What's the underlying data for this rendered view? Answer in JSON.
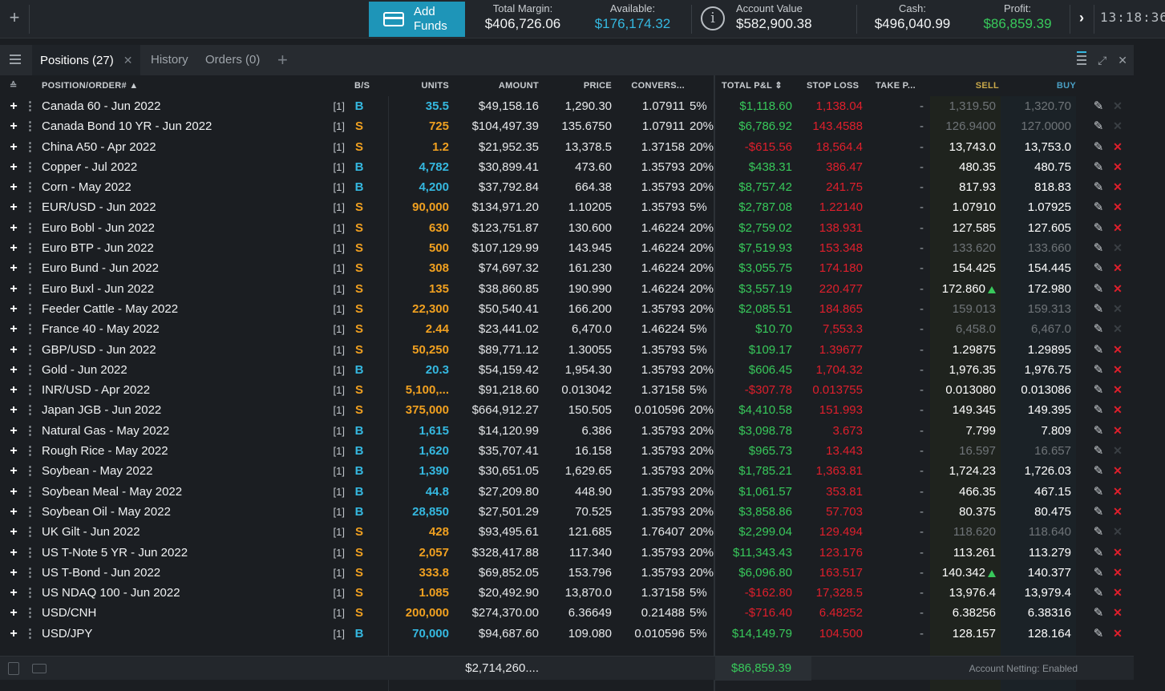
{
  "topbar": {
    "add_funds": "Add\nFunds",
    "total_margin_label": "Total Margin:",
    "total_margin": "$406,726.06",
    "available_label": "Available:",
    "available": "$176,174.32",
    "account_value_label": "Account Value",
    "account_value": "$582,900.38",
    "cash_label": "Cash:",
    "cash": "$496,040.99",
    "profit_label": "Profit:",
    "profit": "$86,859.39",
    "clock": "13:18:36",
    "colors": {
      "accent": "#1e95b8",
      "green": "#38c95b",
      "red": "#e01f2c",
      "blue": "#35b8e0",
      "orange": "#f0a020"
    }
  },
  "tabs": [
    {
      "label": "Positions (27)"
    },
    {
      "label": "History"
    },
    {
      "label": "Orders (0)"
    }
  ],
  "headers": {
    "position": "POSITION/ORDER#",
    "bs": "B/S",
    "units": "UNITS",
    "amount": "AMOUNT",
    "price": "PRICE",
    "conversion": "CONVERS...",
    "pnl": "TOTAL P&L",
    "stop": "STOP LOSS",
    "take": "TAKE P...",
    "sell": "SELL",
    "buy": "BUY"
  },
  "rows": [
    {
      "name": "Canada 60 - Jun 2022",
      "idx": "[1]",
      "bs": "B",
      "units": "35.5",
      "amount": "$49,158.16",
      "price": "1,290.30",
      "conv": "1.07911",
      "lev": "5%",
      "pnl": "$1,118.60",
      "pnl_neg": false,
      "stop": "1,138.04",
      "take": "-",
      "sell": "1,319.50",
      "buy": "1,320.70",
      "active": false
    },
    {
      "name": "Canada Bond 10 YR - Jun 2022",
      "idx": "[1]",
      "bs": "S",
      "units": "725",
      "amount": "$104,497.39",
      "price": "135.6750",
      "conv": "1.07911",
      "lev": "20%",
      "pnl": "$6,786.92",
      "pnl_neg": false,
      "stop": "143.4588",
      "take": "-",
      "sell": "126.9400",
      "buy": "127.0000",
      "active": false
    },
    {
      "name": "China A50 - Apr 2022",
      "idx": "[1]",
      "bs": "S",
      "units": "1.2",
      "amount": "$21,952.35",
      "price": "13,378.5",
      "conv": "1.37158",
      "lev": "20%",
      "pnl": "-$615.56",
      "pnl_neg": true,
      "stop": "18,564.4",
      "take": "-",
      "sell": "13,743.0",
      "buy": "13,753.0",
      "active": true
    },
    {
      "name": "Copper - Jul 2022",
      "idx": "[1]",
      "bs": "B",
      "units": "4,782",
      "amount": "$30,899.41",
      "price": "473.60",
      "conv": "1.35793",
      "lev": "20%",
      "pnl": "$438.31",
      "pnl_neg": false,
      "stop": "386.47",
      "take": "-",
      "sell": "480.35",
      "buy": "480.75",
      "active": true
    },
    {
      "name": "Corn - May 2022",
      "idx": "[1]",
      "bs": "B",
      "units": "4,200",
      "amount": "$37,792.84",
      "price": "664.38",
      "conv": "1.35793",
      "lev": "20%",
      "pnl": "$8,757.42",
      "pnl_neg": false,
      "stop": "241.75",
      "take": "-",
      "sell": "817.93",
      "buy": "818.83",
      "active": true
    },
    {
      "name": "EUR/USD - Jun 2022",
      "idx": "[1]",
      "bs": "S",
      "units": "90,000",
      "amount": "$134,971.20",
      "price": "1.10205",
      "conv": "1.35793",
      "lev": "5%",
      "pnl": "$2,787.08",
      "pnl_neg": false,
      "stop": "1.22140",
      "take": "-",
      "sell": "1.07910",
      "buy": "1.07925",
      "active": true
    },
    {
      "name": "Euro Bobl - Jun 2022",
      "idx": "[1]",
      "bs": "S",
      "units": "630",
      "amount": "$123,751.87",
      "price": "130.600",
      "conv": "1.46224",
      "lev": "20%",
      "pnl": "$2,759.02",
      "pnl_neg": false,
      "stop": "138.931",
      "take": "-",
      "sell": "127.585",
      "buy": "127.605",
      "active": true
    },
    {
      "name": "Euro BTP - Jun 2022",
      "idx": "[1]",
      "bs": "S",
      "units": "500",
      "amount": "$107,129.99",
      "price": "143.945",
      "conv": "1.46224",
      "lev": "20%",
      "pnl": "$7,519.93",
      "pnl_neg": false,
      "stop": "153.348",
      "take": "-",
      "sell": "133.620",
      "buy": "133.660",
      "active": false
    },
    {
      "name": "Euro Bund - Jun 2022",
      "idx": "[1]",
      "bs": "S",
      "units": "308",
      "amount": "$74,697.32",
      "price": "161.230",
      "conv": "1.46224",
      "lev": "20%",
      "pnl": "$3,055.75",
      "pnl_neg": false,
      "stop": "174.180",
      "take": "-",
      "sell": "154.425",
      "buy": "154.445",
      "active": true
    },
    {
      "name": "Euro Buxl - Jun 2022",
      "idx": "[1]",
      "bs": "S",
      "units": "135",
      "amount": "$38,860.85",
      "price": "190.990",
      "conv": "1.46224",
      "lev": "20%",
      "pnl": "$3,557.19",
      "pnl_neg": false,
      "stop": "220.477",
      "take": "-",
      "sell": "172.860",
      "buy": "172.980",
      "active": true,
      "sell_up": true
    },
    {
      "name": "Feeder Cattle - May 2022",
      "idx": "[1]",
      "bs": "S",
      "units": "22,300",
      "amount": "$50,540.41",
      "price": "166.200",
      "conv": "1.35793",
      "lev": "20%",
      "pnl": "$2,085.51",
      "pnl_neg": false,
      "stop": "184.865",
      "take": "-",
      "sell": "159.013",
      "buy": "159.313",
      "active": false
    },
    {
      "name": "France 40 - May 2022",
      "idx": "[1]",
      "bs": "S",
      "units": "2.44",
      "amount": "$23,441.02",
      "price": "6,470.0",
      "conv": "1.46224",
      "lev": "5%",
      "pnl": "$10.70",
      "pnl_neg": false,
      "stop": "7,553.3",
      "take": "-",
      "sell": "6,458.0",
      "buy": "6,467.0",
      "active": false
    },
    {
      "name": "GBP/USD - Jun 2022",
      "idx": "[1]",
      "bs": "S",
      "units": "50,250",
      "amount": "$89,771.12",
      "price": "1.30055",
      "conv": "1.35793",
      "lev": "5%",
      "pnl": "$109.17",
      "pnl_neg": false,
      "stop": "1.39677",
      "take": "-",
      "sell": "1.29875",
      "buy": "1.29895",
      "active": true
    },
    {
      "name": "Gold - Jun 2022",
      "idx": "[1]",
      "bs": "B",
      "units": "20.3",
      "amount": "$54,159.42",
      "price": "1,954.30",
      "conv": "1.35793",
      "lev": "20%",
      "pnl": "$606.45",
      "pnl_neg": false,
      "stop": "1,704.32",
      "take": "-",
      "sell": "1,976.35",
      "buy": "1,976.75",
      "active": true
    },
    {
      "name": "INR/USD - Apr 2022",
      "idx": "[1]",
      "bs": "S",
      "units": "5,100,...",
      "amount": "$91,218.60",
      "price": "0.013042",
      "conv": "1.37158",
      "lev": "5%",
      "pnl": "-$307.78",
      "pnl_neg": true,
      "stop": "0.013755",
      "take": "-",
      "sell": "0.013080",
      "buy": "0.013086",
      "active": true
    },
    {
      "name": "Japan JGB - Jun 2022",
      "idx": "[1]",
      "bs": "S",
      "units": "375,000",
      "amount": "$664,912.27",
      "price": "150.505",
      "conv": "0.010596",
      "lev": "20%",
      "pnl": "$4,410.58",
      "pnl_neg": false,
      "stop": "151.993",
      "take": "-",
      "sell": "149.345",
      "buy": "149.395",
      "active": true
    },
    {
      "name": "Natural Gas - May 2022",
      "idx": "[1]",
      "bs": "B",
      "units": "1,615",
      "amount": "$14,120.99",
      "price": "6.386",
      "conv": "1.35793",
      "lev": "20%",
      "pnl": "$3,098.78",
      "pnl_neg": false,
      "stop": "3.673",
      "take": "-",
      "sell": "7.799",
      "buy": "7.809",
      "active": true
    },
    {
      "name": "Rough Rice - May 2022",
      "idx": "[1]",
      "bs": "B",
      "units": "1,620",
      "amount": "$35,707.41",
      "price": "16.158",
      "conv": "1.35793",
      "lev": "20%",
      "pnl": "$965.73",
      "pnl_neg": false,
      "stop": "13.443",
      "take": "-",
      "sell": "16.597",
      "buy": "16.657",
      "active": false
    },
    {
      "name": "Soybean - May 2022",
      "idx": "[1]",
      "bs": "B",
      "units": "1,390",
      "amount": "$30,651.05",
      "price": "1,629.65",
      "conv": "1.35793",
      "lev": "20%",
      "pnl": "$1,785.21",
      "pnl_neg": false,
      "stop": "1,363.81",
      "take": "-",
      "sell": "1,724.23",
      "buy": "1,726.03",
      "active": true
    },
    {
      "name": "Soybean Meal - May 2022",
      "idx": "[1]",
      "bs": "B",
      "units": "44.8",
      "amount": "$27,209.80",
      "price": "448.90",
      "conv": "1.35793",
      "lev": "20%",
      "pnl": "$1,061.57",
      "pnl_neg": false,
      "stop": "353.81",
      "take": "-",
      "sell": "466.35",
      "buy": "467.15",
      "active": true
    },
    {
      "name": "Soybean Oil - May 2022",
      "idx": "[1]",
      "bs": "B",
      "units": "28,850",
      "amount": "$27,501.29",
      "price": "70.525",
      "conv": "1.35793",
      "lev": "20%",
      "pnl": "$3,858.86",
      "pnl_neg": false,
      "stop": "57.703",
      "take": "-",
      "sell": "80.375",
      "buy": "80.475",
      "active": true
    },
    {
      "name": "UK Gilt - Jun 2022",
      "idx": "[1]",
      "bs": "S",
      "units": "428",
      "amount": "$93,495.61",
      "price": "121.685",
      "conv": "1.76407",
      "lev": "20%",
      "pnl": "$2,299.04",
      "pnl_neg": false,
      "stop": "129.494",
      "take": "-",
      "sell": "118.620",
      "buy": "118.640",
      "active": false
    },
    {
      "name": "US T-Note 5 YR - Jun 2022",
      "idx": "[1]",
      "bs": "S",
      "units": "2,057",
      "amount": "$328,417.88",
      "price": "117.340",
      "conv": "1.35793",
      "lev": "20%",
      "pnl": "$11,343.43",
      "pnl_neg": false,
      "stop": "123.176",
      "take": "-",
      "sell": "113.261",
      "buy": "113.279",
      "active": true
    },
    {
      "name": "US T-Bond - Jun 2022",
      "idx": "[1]",
      "bs": "S",
      "units": "333.8",
      "amount": "$69,852.05",
      "price": "153.796",
      "conv": "1.35793",
      "lev": "20%",
      "pnl": "$6,096.80",
      "pnl_neg": false,
      "stop": "163.517",
      "take": "-",
      "sell": "140.342",
      "buy": "140.377",
      "active": true,
      "sell_up": true
    },
    {
      "name": "US NDAQ 100 - Jun 2022",
      "idx": "[1]",
      "bs": "S",
      "units": "1.085",
      "amount": "$20,492.90",
      "price": "13,870.0",
      "conv": "1.37158",
      "lev": "5%",
      "pnl": "-$162.80",
      "pnl_neg": true,
      "stop": "17,328.5",
      "take": "-",
      "sell": "13,976.4",
      "buy": "13,979.4",
      "active": true
    },
    {
      "name": "USD/CNH",
      "idx": "[1]",
      "bs": "S",
      "units": "200,000",
      "amount": "$274,370.00",
      "price": "6.36649",
      "conv": "0.21488",
      "lev": "5%",
      "pnl": "-$716.40",
      "pnl_neg": true,
      "stop": "6.48252",
      "take": "-",
      "sell": "6.38256",
      "buy": "6.38316",
      "active": true
    },
    {
      "name": "USD/JPY",
      "idx": "[1]",
      "bs": "B",
      "units": "70,000",
      "amount": "$94,687.60",
      "price": "109.080",
      "conv": "0.010596",
      "lev": "5%",
      "pnl": "$14,149.79",
      "pnl_neg": false,
      "stop": "104.500",
      "take": "-",
      "sell": "128.157",
      "buy": "128.164",
      "active": true
    }
  ],
  "footer": {
    "total_amount": "$2,714,260....",
    "total_pnl": "$86,859.39",
    "netting": "Account Netting: Enabled"
  }
}
